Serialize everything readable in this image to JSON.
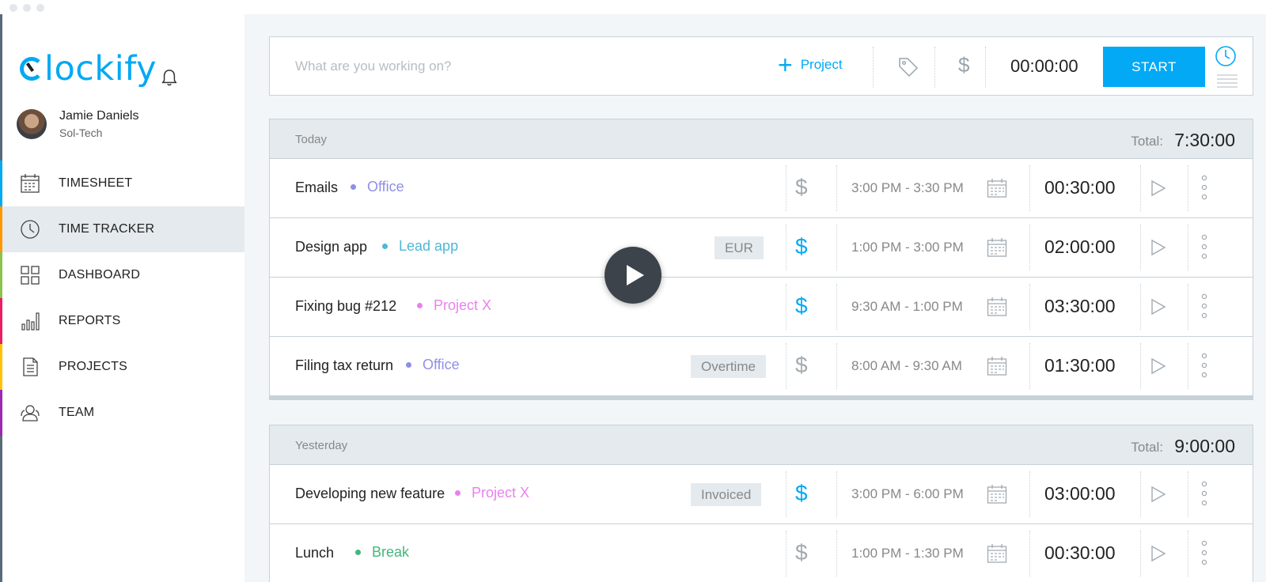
{
  "app": {
    "logo_text": "lockify",
    "brand_color": "#03a9f4"
  },
  "user": {
    "name": "Jamie Daniels",
    "org": "Sol-Tech"
  },
  "nav": [
    {
      "label": "TIMESHEET",
      "icon": "calendar-icon",
      "color": "#03a9f4"
    },
    {
      "label": "TIME TRACKER",
      "icon": "clock-icon",
      "color": "#ff9800",
      "active": true
    },
    {
      "label": "DASHBOARD",
      "icon": "grid-icon",
      "color": "#8bc34a"
    },
    {
      "label": "REPORTS",
      "icon": "bar-chart-icon",
      "color": "#e91e63"
    },
    {
      "label": "PROJECTS",
      "icon": "document-icon",
      "color": "#ffc107"
    },
    {
      "label": "TEAM",
      "icon": "team-icon",
      "color": "#9c27b0"
    }
  ],
  "tracker": {
    "placeholder": "What are you working on?",
    "project_label": "Project",
    "timer": "00:00:00",
    "start_label": "START"
  },
  "groups": [
    {
      "label": "Today",
      "total_label": "Total:",
      "total": "7:30:00",
      "entries": [
        {
          "desc": "Emails",
          "project": "Office",
          "project_color": "#8f8fe8",
          "tag": "",
          "billable": false,
          "range": "3:00 PM - 3:30 PM",
          "duration": "00:30:00"
        },
        {
          "desc": "Design app",
          "project": "Lead app",
          "project_color": "#4fb8d4",
          "tag": "EUR",
          "billable": true,
          "range": "1:00 PM - 3:00 PM",
          "duration": "02:00:00"
        },
        {
          "desc": "Fixing bug #212",
          "project": "Project X",
          "project_color": "#ea80f0",
          "tag": "",
          "billable": true,
          "range": "9:30 AM - 1:00 PM",
          "duration": "03:30:00"
        },
        {
          "desc": "Filing tax return",
          "project": "Office",
          "project_color": "#8f8fe8",
          "tag": "Overtime",
          "billable": false,
          "range": "8:00 AM - 9:30 AM",
          "duration": "01:30:00"
        }
      ]
    },
    {
      "label": "Yesterday",
      "total_label": "Total:",
      "total": "9:00:00",
      "entries": [
        {
          "desc": "Developing new feature",
          "project": "Project X",
          "project_color": "#ea80f0",
          "tag": "Invoiced",
          "billable": true,
          "range": "3:00 PM - 6:00 PM",
          "duration": "03:00:00"
        },
        {
          "desc": "Lunch",
          "project": "Break",
          "project_color": "#43b77a",
          "tag": "",
          "billable": false,
          "range": "1:00 PM - 1:30 PM",
          "duration": "00:30:00"
        }
      ]
    }
  ],
  "symbols": {
    "dollar": "$"
  }
}
